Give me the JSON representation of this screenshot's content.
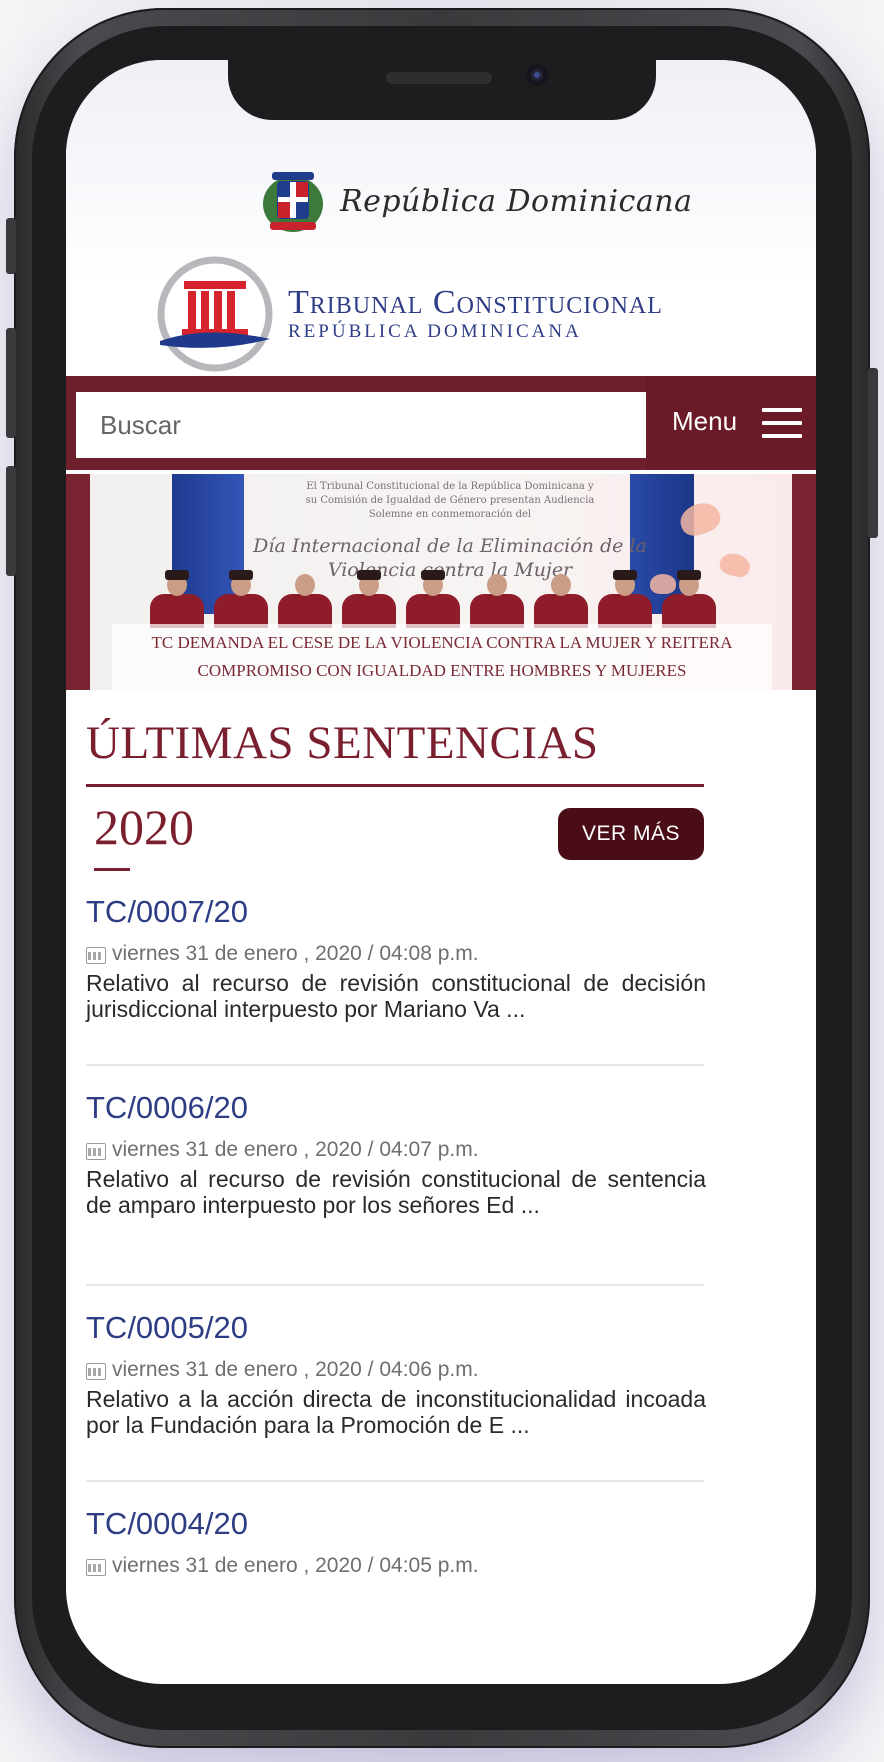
{
  "header": {
    "country_text": "República Dominicana",
    "org_name": "Tribunal Constitucional",
    "org_subtitle": "REPÚBLICA DOMINICANA"
  },
  "search": {
    "placeholder": "Buscar"
  },
  "menu": {
    "label": "Menu"
  },
  "banner": {
    "small_text": "El Tribunal Constitucional de la República Dominicana y su Comisión de Igualdad de Género presentan Audiencia Solemne en conmemoración del",
    "title_text": "Día Internacional de la Eliminación de la Violencia contra la Mujer",
    "caption": "TC DEMANDA EL CESE DE LA VIOLENCIA CONTRA LA MUJER Y REITERA COMPROMISO CON IGUALDAD ENTRE HOMBRES Y MUJERES"
  },
  "section": {
    "title": "ÚLTIMAS SENTENCIAS",
    "year": "2020",
    "more_button": "VER MÁS"
  },
  "sentences": [
    {
      "code": "TC/0007/20",
      "date": "viernes 31 de enero , 2020 / 04:08 p.m.",
      "desc": "Relativo al recurso de revisión constitucional de decisión jurisdiccional interpuesto por Mariano Va ..."
    },
    {
      "code": "TC/0006/20",
      "date": "viernes 31 de enero , 2020 / 04:07 p.m.",
      "desc": "Relativo al recurso de revisión constitucional de sentencia de amparo interpuesto por los señores Ed ..."
    },
    {
      "code": "TC/0005/20",
      "date": "viernes 31 de enero , 2020 / 04:06 p.m.",
      "desc": "Relativo a la acción directa de inconstitucionalidad incoada por la Fundación para la Promoción de E ..."
    },
    {
      "code": "TC/0004/20",
      "date": "viernes 31 de enero , 2020 / 04:05 p.m.",
      "desc": ""
    }
  ],
  "colors": {
    "brand": "#6e1f2b",
    "title": "#7a1f2e",
    "link": "#2f3e84"
  }
}
